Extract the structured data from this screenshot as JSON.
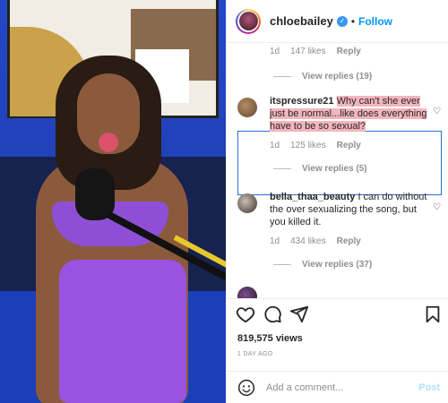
{
  "header": {
    "username": "chloebailey",
    "verified_icon": "verified-badge-icon",
    "separator": "•",
    "follow_label": "Follow"
  },
  "comments": [
    {
      "meta": {
        "time": "1d",
        "likes": "147 likes",
        "reply": "Reply"
      },
      "view_replies": "View replies (19)"
    },
    {
      "username": "itspressure21",
      "text": "Why can't she ever just be normal...like does everything have to be so sexual?",
      "meta": {
        "time": "1d",
        "likes": "125 likes",
        "reply": "Reply"
      },
      "view_replies": "View replies (5)"
    },
    {
      "username": "bella_thaa_beauty",
      "text": "I can do without the over sexualizing the song, but you killed it.",
      "meta": {
        "time": "1d",
        "likes": "434 likes",
        "reply": "Reply"
      },
      "view_replies": "View replies (37)"
    }
  ],
  "actions": {
    "views": "819,575 views",
    "time_ago": "1 DAY AGO"
  },
  "add_comment": {
    "placeholder": "Add a comment...",
    "post_label": "Post"
  },
  "colors": {
    "accent": "#0095f6",
    "highlight": "#f3b5bd",
    "box_border": "#2b6fd6"
  }
}
